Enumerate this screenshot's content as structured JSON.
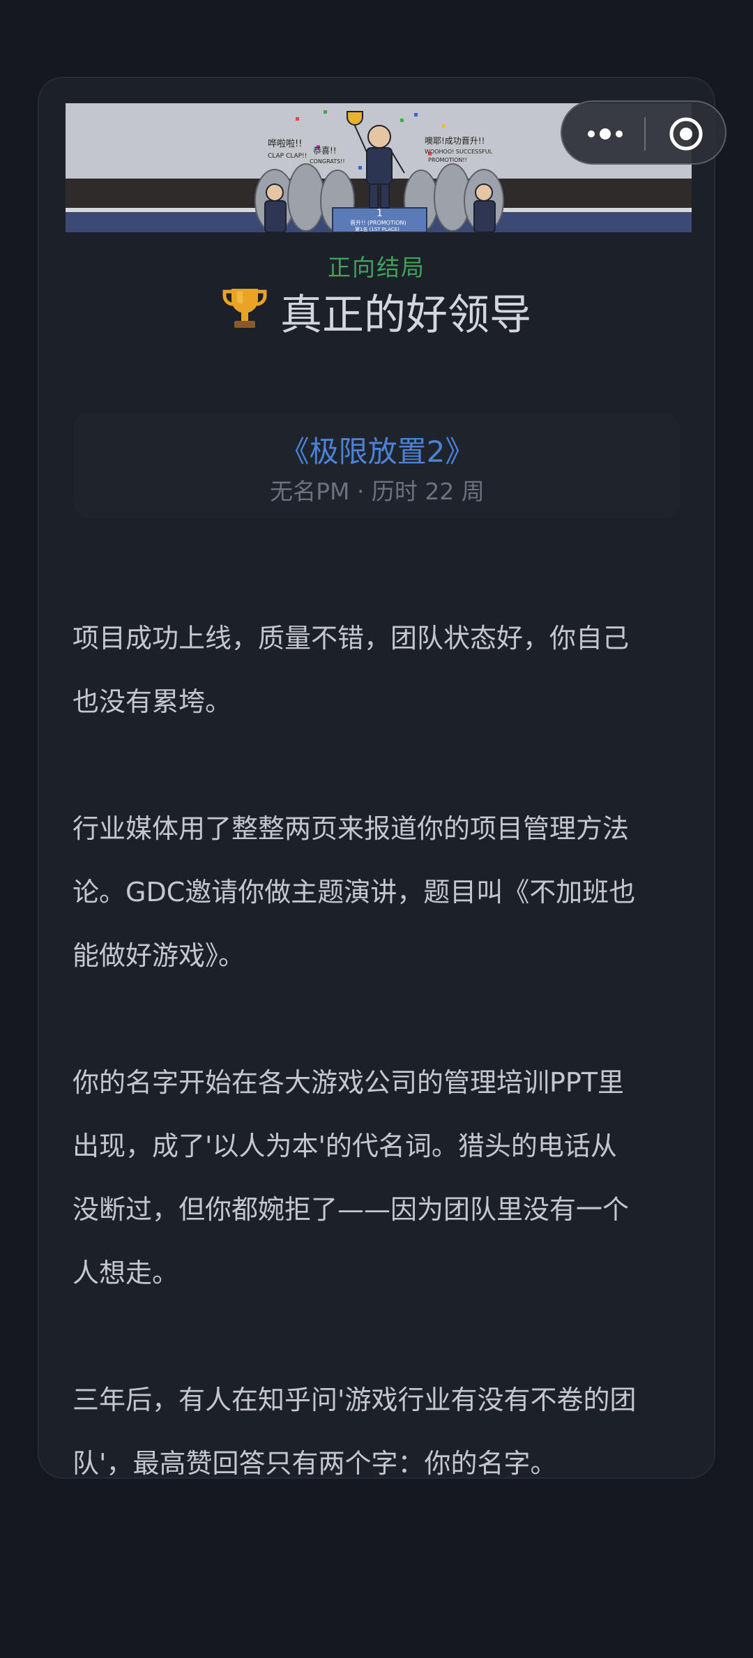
{
  "ending": {
    "type_label": "正向结局",
    "title": "真正的好领导",
    "trophy_icon": "trophy-icon"
  },
  "game": {
    "name": "《极限放置2》",
    "meta": "无名PM · 历时 22 周"
  },
  "banner": {
    "captions": {
      "left": "哗啦啦!!",
      "left_en": "CLAP CLAP!!",
      "mid": "恭喜!!",
      "mid_en": "CONGRATS!!",
      "right": "噢耶!成功晋升!!",
      "right_en": "WOOHOO! SUCCESSFUL",
      "right_en2": "PROMOTION!!",
      "podium_number": "1",
      "podium_label": "晋升!! (PROMOTION)",
      "podium_sub": "第1名 (1ST PLACE)"
    }
  },
  "story": {
    "paragraphs": [
      "项目成功上线，质量不错，团队状态好，你自己也没有累垮。",
      "行业媒体用了整整两页来报道你的项目管理方法论。GDC邀请你做主题演讲，题目叫《不加班也能做好游戏》。",
      "你的名字开始在各大游戏公司的管理培训PPT里出现，成了'以人为本'的代名词。猎头的电话从没断过，但你都婉拒了——因为团队里没有一个人想走。",
      "三年后，有人在知乎问'游戏行业有没有不卷的团队'，最高赞回答只有两个字：你的名字。"
    ]
  },
  "capsule": {
    "more_icon": "more-dots-icon",
    "close_icon": "close-miniprogram-icon"
  },
  "colors": {
    "page_bg": "#15181f",
    "card_bg": "#1c2029",
    "positive_green": "#3fa35b",
    "link_blue": "#4c82d6",
    "text": "#c4c7ce"
  }
}
